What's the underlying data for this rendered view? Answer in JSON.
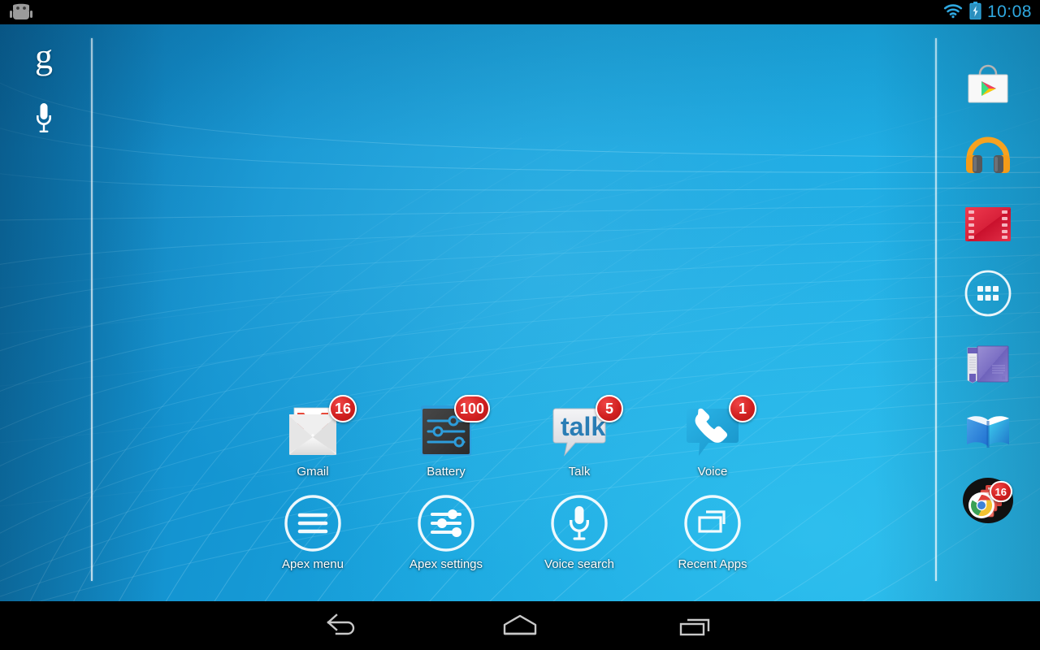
{
  "status_bar": {
    "left_icon": "android-robot-icon",
    "wifi_icon": "wifi-icon",
    "battery_icon": "battery-charging-icon",
    "time": "10:08",
    "accent_color": "#2fa8e0",
    "background_color": "#000000"
  },
  "search_bar": {
    "google_logo": "g",
    "google_logo_name": "google-g-icon",
    "voice_icon": "microphone-icon"
  },
  "wallpaper": {
    "name": "blue-mesh-wallpaper",
    "base_color": "#18a3dd",
    "highlight_color": "#3ccdf5"
  },
  "home_screen": {
    "rows": [
      {
        "apps": [
          {
            "label": "Gmail",
            "icon": "gmail-icon",
            "badge": "16"
          },
          {
            "label": "Battery",
            "icon": "battery-settings-icon",
            "badge": "100"
          },
          {
            "label": "Talk",
            "icon": "talk-icon",
            "badge": "5"
          },
          {
            "label": "Voice",
            "icon": "voice-icon",
            "badge": "1"
          }
        ]
      },
      {
        "apps": [
          {
            "label": "Apex menu",
            "icon": "hamburger-menu-icon",
            "badge": ""
          },
          {
            "label": "Apex settings",
            "icon": "sliders-icon",
            "badge": ""
          },
          {
            "label": "Voice search",
            "icon": "microphone-icon",
            "badge": ""
          },
          {
            "label": "Recent Apps",
            "icon": "recents-icon",
            "badge": ""
          }
        ]
      }
    ]
  },
  "dock": {
    "items": [
      {
        "name": "Play Store",
        "icon": "play-store-icon",
        "badge": ""
      },
      {
        "name": "Play Music",
        "icon": "play-music-icon",
        "badge": ""
      },
      {
        "name": "Play Movies",
        "icon": "play-movies-icon",
        "badge": ""
      },
      {
        "name": "All Apps",
        "icon": "app-drawer-icon",
        "badge": ""
      },
      {
        "name": "Play Magazines",
        "icon": "play-magazines-icon",
        "badge": ""
      },
      {
        "name": "Play Books",
        "icon": "play-books-icon",
        "badge": ""
      },
      {
        "name": "Chrome folder",
        "icon": "chrome-folder-icon",
        "badge": "16"
      }
    ]
  },
  "nav_bar": {
    "back_label": "Back",
    "home_label": "Home",
    "recents_label": "Recent apps",
    "icon_color": "#c8c8c8",
    "background_color": "#000000"
  },
  "badge_color": "#d01f1f"
}
